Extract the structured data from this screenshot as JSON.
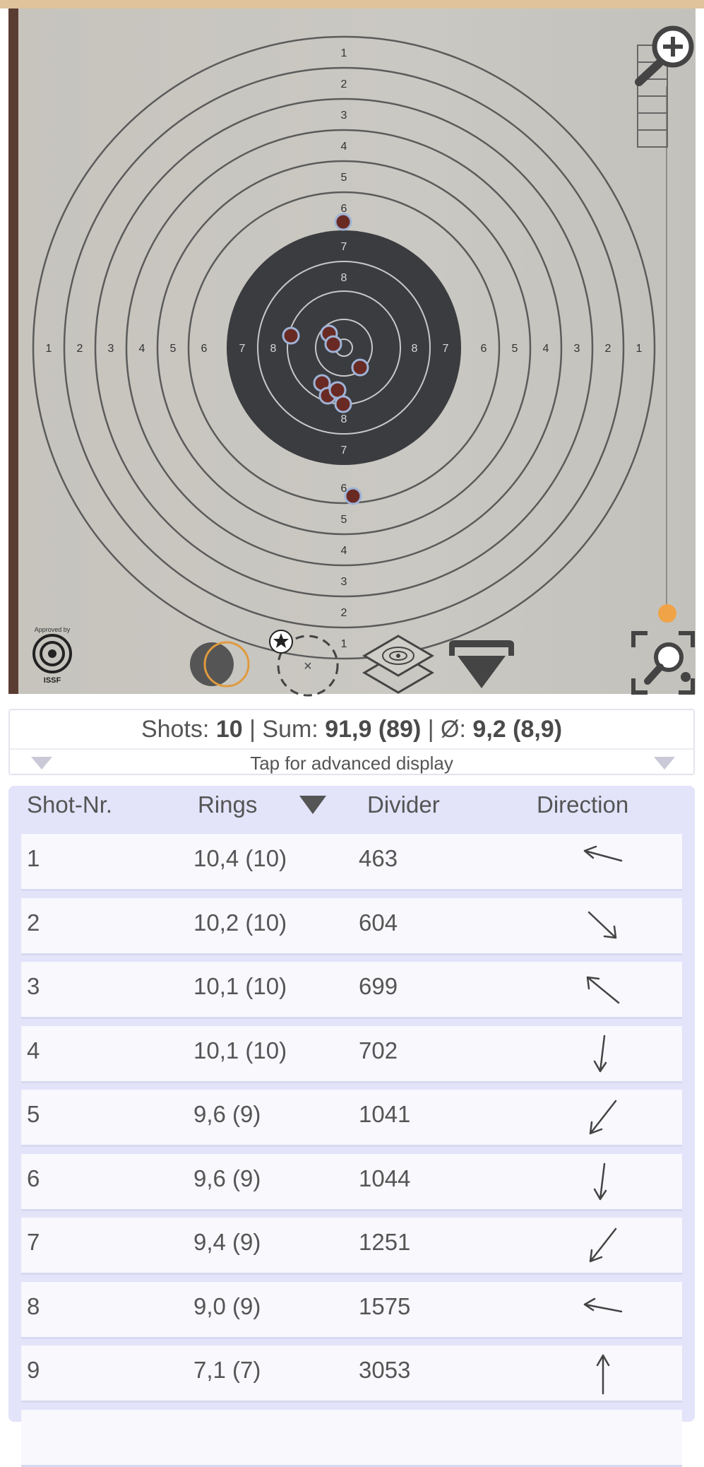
{
  "target": {
    "ring_numbers": [
      "1",
      "2",
      "3",
      "4",
      "5",
      "6",
      "7",
      "8"
    ],
    "approved_by": "Approved by",
    "issf": "ISSF"
  },
  "toolbar": {
    "zoom_in_icon": "magnifier-plus-icon",
    "zoom_fit_icon": "magnifier-fit-icon",
    "contrast_icon": "contrast-toggle-icon",
    "mark_shot_icon": "mark-shot-icon",
    "layers_icon": "layers-icon",
    "dropdown_icon": "dropdown-icon",
    "accent_color": "#f0a347"
  },
  "zoom_slider": {
    "level": 0.02
  },
  "summary": {
    "shots_label": "Shots:",
    "shots_value": "10",
    "sep1": "|",
    "sum_label": "Sum:",
    "sum_value": "91,9 (89)",
    "sep2": "|",
    "avg_label": "Ø:",
    "avg_value": "9,2 (8,9)",
    "hint": "Tap for advanced display"
  },
  "table": {
    "headers": {
      "shot_nr": "Shot-Nr.",
      "rings": "Rings",
      "divider": "Divider",
      "direction": "Direction"
    },
    "rows": [
      {
        "nr": "1",
        "rings": "10,4 (10)",
        "divider": "463",
        "direction": "up-left-shallow"
      },
      {
        "nr": "2",
        "rings": "10,2 (10)",
        "divider": "604",
        "direction": "down-right"
      },
      {
        "nr": "3",
        "rings": "10,1 (10)",
        "divider": "699",
        "direction": "up-left"
      },
      {
        "nr": "4",
        "rings": "10,1 (10)",
        "divider": "702",
        "direction": "down"
      },
      {
        "nr": "5",
        "rings": "9,6 (9)",
        "divider": "1041",
        "direction": "down-left"
      },
      {
        "nr": "6",
        "rings": "9,6 (9)",
        "divider": "1044",
        "direction": "down"
      },
      {
        "nr": "7",
        "rings": "9,4 (9)",
        "divider": "1251",
        "direction": "down-left"
      },
      {
        "nr": "8",
        "rings": "9,0 (9)",
        "divider": "1575",
        "direction": "left"
      },
      {
        "nr": "9",
        "rings": "7,1 (7)",
        "divider": "3053",
        "direction": "up"
      }
    ]
  }
}
